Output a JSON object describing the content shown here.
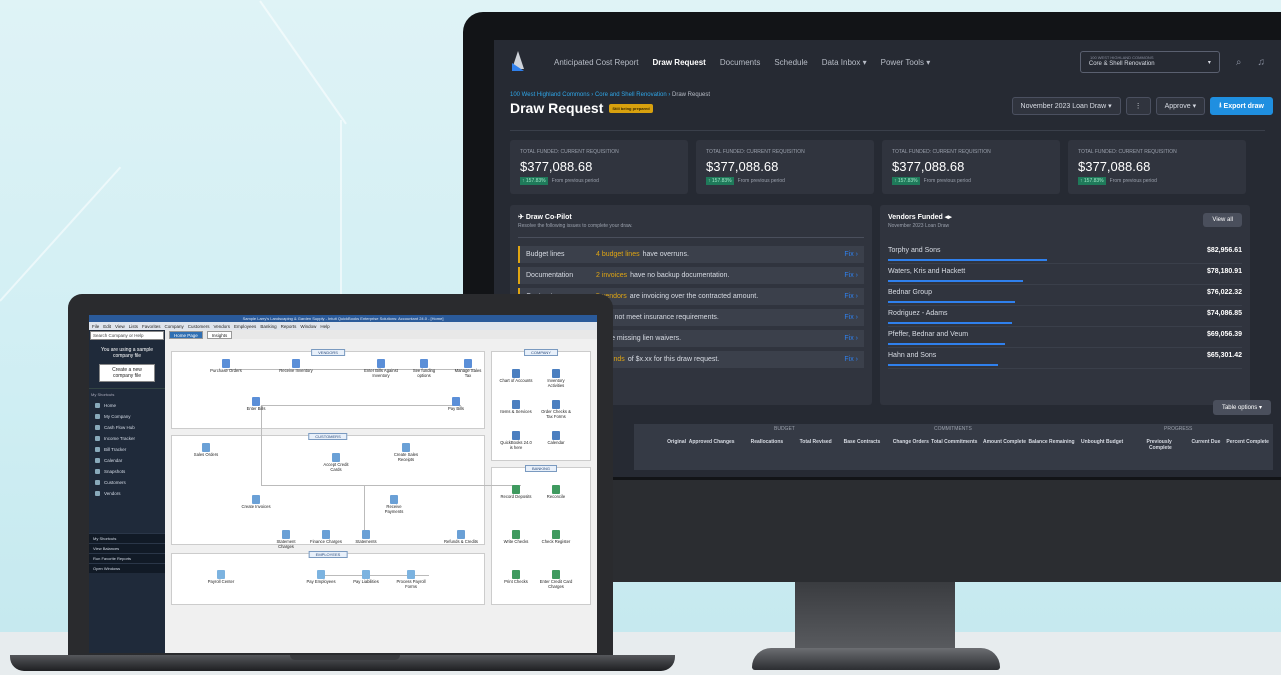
{
  "app": {
    "nav": [
      "Anticipated Cost Report",
      "Draw Request",
      "Documents",
      "Schedule",
      "Data Inbox ▾",
      "Power Tools ▾"
    ],
    "active_nav": "Draw Request",
    "project_top": "100 WEST HIGHLAND COMMONS",
    "project": "Core & Shell Renovation",
    "breadcrumb": [
      "100 West Highland Commons",
      "Core and Shell Renovation",
      "Draw Request"
    ],
    "title": "Draw Request",
    "status_badge": "Still being prepared",
    "draw_select": "November 2023 Loan Draw",
    "approve": "Approve",
    "export": "Export draw",
    "kpis": [
      {
        "label": "Total Funded: Current Requisition",
        "value": "$377,088.68",
        "delta": "157.83%",
        "note": "From previous period"
      },
      {
        "label": "Total Funded: Current Requisition",
        "value": "$377,088.68",
        "delta": "157.83%",
        "note": "From previous period"
      },
      {
        "label": "Total Funded: Current Requisition",
        "value": "$377,088.68",
        "delta": "157.83%",
        "note": "From previous period"
      },
      {
        "label": "Total Funded: Current Requisition",
        "value": "$377,088.68",
        "delta": "157.83%",
        "note": "From previous period"
      }
    ],
    "copilot": {
      "title": "Draw Co-Pilot",
      "subtitle": "Resolve the following issues to complete your draw.",
      "fix": "Fix",
      "issues": [
        {
          "cat": "Budget lines",
          "hl": "4 budget lines",
          "text": "have overruns."
        },
        {
          "cat": "Documentation",
          "hl": "2 invoices",
          "text": "have no backup documentation."
        },
        {
          "cat": "Contracts",
          "hl": "5 vendors",
          "text": "are invoicing over the contracted amount."
        },
        {
          "cat": "",
          "hl": "rs",
          "text": "do not meet insurance requirements."
        },
        {
          "cat": "",
          "hl": "rs",
          "text": "are missing lien waivers."
        },
        {
          "cat": "",
          "hl": "ent funds",
          "text": "of $x.xx for this draw request."
        }
      ]
    },
    "vendors": {
      "title": "Vendors Funded",
      "subtitle": "November 2023 Loan Draw",
      "view_all": "View all",
      "rows": [
        {
          "name": "Torphy and Sons",
          "amount": "$82,956.61",
          "share": 0.45
        },
        {
          "name": "Waters, Kris and Hackett",
          "amount": "$78,180.91",
          "share": 0.38
        },
        {
          "name": "Bednar Group",
          "amount": "$76,022.32",
          "share": 0.36
        },
        {
          "name": "Rodriguez - Adams",
          "amount": "$74,086.85",
          "share": 0.35
        },
        {
          "name": "Pfeffer, Bednar and Veum",
          "amount": "$69,056.39",
          "share": 0.33
        },
        {
          "name": "Hahn and Sons",
          "amount": "$65,301.42",
          "share": 0.31
        }
      ]
    },
    "table_options": "Table options",
    "table_groups": [
      "BUDGET",
      "COMMITMENTS",
      "PROGRESS"
    ],
    "table_cols": [
      "Original",
      "Approved Changes",
      "Reallocations",
      "Total Revised",
      "Base Contracts",
      "Change Orders",
      "Total Commitments",
      "Amount Complete",
      "Balance Remaining",
      "Unbought Budget",
      "Previously Complete",
      "Current Due",
      "Percent Complete"
    ]
  },
  "qb": {
    "title": "Sample Larry's Landscaping & Garden Supply - Intuit QuickBooks Enterprise Solutions: Accountant 24.0 - [Home]",
    "menu": [
      "File",
      "Edit",
      "View",
      "Lists",
      "Favorites",
      "Company",
      "Customers",
      "Vendors",
      "Employees",
      "Banking",
      "Reports",
      "Window",
      "Help"
    ],
    "tabs": [
      "Home Page",
      "Insights"
    ],
    "search": "Search Company or Help",
    "sample_msg": "You are using a sample company file",
    "create_btn": "Create a new company file",
    "shortcuts_label": "My Shortcuts",
    "shortcuts": [
      "Home",
      "My Company",
      "Cash Flow Hub",
      "Income Tracker",
      "Bill Tracker",
      "Calendar",
      "Snapshots",
      "Customers",
      "Vendors"
    ],
    "footer": [
      "My Shortcuts",
      "View Balances",
      "Run Favorite Reports",
      "Open Windows"
    ],
    "sections": {
      "vendors": "VENDORS",
      "customers": "CUSTOMERS",
      "employees": "EMPLOYEES",
      "company": "COMPANY",
      "banking": "BANKING"
    },
    "vendor_nodes": [
      "Purchase Orders",
      "Receive Inventory",
      "Enter Bills Against Inventory",
      "See funding options",
      "Manage Sales Tax",
      "Enter Bills",
      "Pay Bills"
    ],
    "customer_nodes": [
      "Sales Orders",
      "Accept Credit Cards",
      "Create Sales Receipts",
      "Create Invoices",
      "Receive Payments",
      "Statement Charges",
      "Finance Charges",
      "Statements",
      "Refunds & Credits"
    ],
    "employee_nodes": [
      "Payroll Center",
      "Pay Employees",
      "Pay Liabilities",
      "Process Payroll Forms"
    ],
    "company_nodes": [
      "Chart of Accounts",
      "Inventory Activities",
      "Items & Services",
      "Order Checks & Tax Forms",
      "QuickBooks 24.0 is here",
      "Calendar"
    ],
    "banking_nodes": [
      "Record Deposits",
      "Reconcile",
      "Write Checks",
      "Check Register",
      "Print Checks",
      "Enter Credit Card Charges"
    ]
  }
}
